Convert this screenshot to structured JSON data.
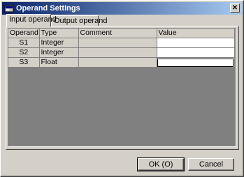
{
  "window": {
    "title": "Operand Settings",
    "close_glyph": "✕"
  },
  "tabs": [
    {
      "label": "Input operand"
    },
    {
      "label": "Output operand"
    }
  ],
  "table": {
    "columns": [
      "Operand",
      "Type",
      "Comment",
      "Value"
    ],
    "rows": [
      {
        "operand": "S1",
        "type": "Integer",
        "comment": "",
        "value": ""
      },
      {
        "operand": "S2",
        "type": "Integer",
        "comment": "",
        "value": ""
      },
      {
        "operand": "S3",
        "type": "Float",
        "comment": "",
        "value": ""
      }
    ]
  },
  "buttons": {
    "ok": "OK (O)",
    "cancel": "Cancel"
  },
  "colors": {
    "title_start": "#0a246a",
    "title_end": "#a6caf0",
    "face": "#d4d0c8",
    "grid_bg": "#808080"
  }
}
